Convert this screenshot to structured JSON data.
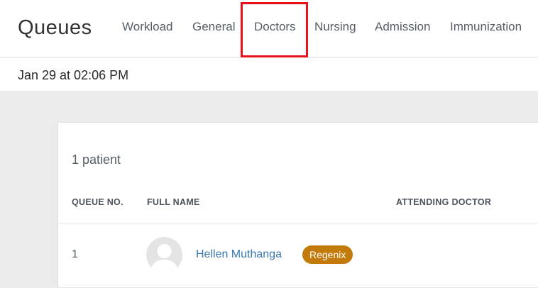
{
  "header": {
    "title": "Queues",
    "tabs": [
      "Workload",
      "General",
      "Doctors",
      "Nursing",
      "Admission",
      "Immunization"
    ],
    "active_tab": "Doctors"
  },
  "subheader": {
    "timestamp": "Jan 29 at 02:06 PM"
  },
  "queue": {
    "count_label": "1 patient",
    "columns": [
      "QUEUE NO.",
      "FULL NAME",
      "ATTENDING DOCTOR"
    ],
    "rows": [
      {
        "queue_no": "1",
        "full_name": "Hellen Muthanga",
        "tag": "Regenix",
        "attending_doctor": ""
      }
    ]
  },
  "colors": {
    "highlight": "#e8101a",
    "link": "#3a78b5",
    "badge": "#c27a0b"
  }
}
